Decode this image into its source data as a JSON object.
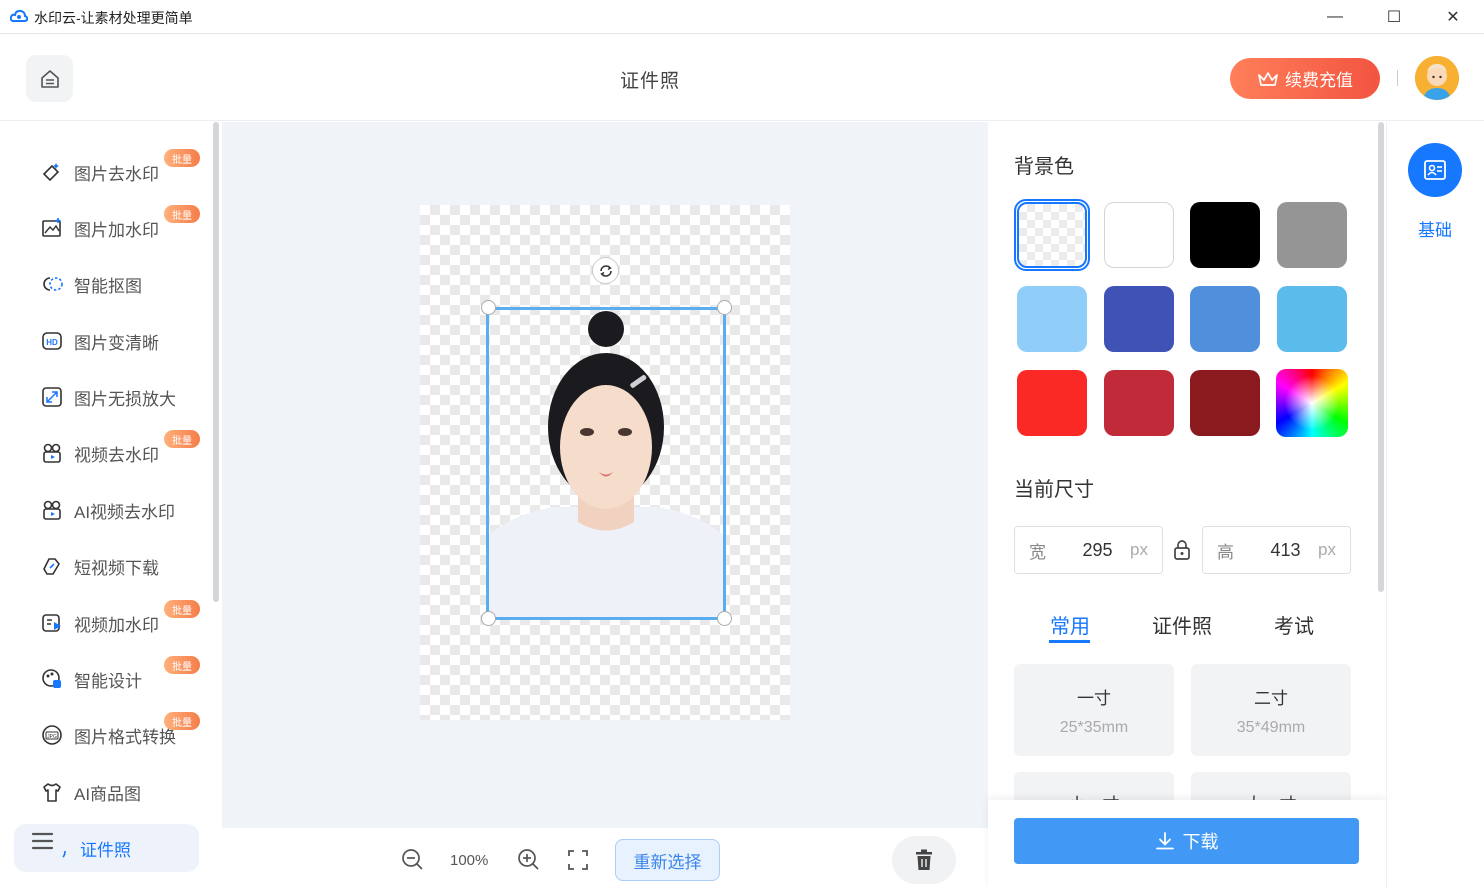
{
  "window": {
    "title": "水印云-让素材处理更简单",
    "minimize": "—",
    "maximize": "☐",
    "close": "✕"
  },
  "header": {
    "page_title": "证件照",
    "recharge_label": "续费充值"
  },
  "sidebar": {
    "items": [
      {
        "label": "图片去水印",
        "badge": "批量",
        "icon": "eraser-icon"
      },
      {
        "label": "图片加水印",
        "badge": "批量",
        "icon": "image-add-icon"
      },
      {
        "label": "智能抠图",
        "badge": "",
        "icon": "cutout-icon"
      },
      {
        "label": "图片变清晰",
        "badge": "",
        "icon": "hd-icon"
      },
      {
        "label": "图片无损放大",
        "badge": "",
        "icon": "enlarge-icon"
      },
      {
        "label": "视频去水印",
        "badge": "批量",
        "icon": "video-eraser-icon"
      },
      {
        "label": "AI视频去水印",
        "badge": "",
        "icon": "ai-video-icon"
      },
      {
        "label": "短视频下载",
        "badge": "",
        "icon": "link-download-icon"
      },
      {
        "label": "视频加水印",
        "badge": "批量",
        "icon": "video-add-icon"
      },
      {
        "label": "智能设计",
        "badge": "批量",
        "icon": "design-icon"
      },
      {
        "label": "图片格式转换",
        "badge": "批量",
        "icon": "jpg-icon"
      },
      {
        "label": "AI商品图",
        "badge": "",
        "icon": "shirt-icon"
      },
      {
        "label": "证件照",
        "badge": "",
        "icon": "id-photo-icon"
      }
    ]
  },
  "canvas": {
    "zoom": "100%",
    "reselect_label": "重新选择"
  },
  "panel": {
    "background_label": "背景色",
    "swatches": [
      "transparent",
      "#ffffff",
      "#000000",
      "#959595",
      "#90cdf8",
      "#3f52b6",
      "#4f8fdb",
      "#5bbbeb",
      "#fa2925",
      "#c12a38",
      "#8b1a1e",
      "gradient"
    ],
    "size_label": "当前尺寸",
    "width_label": "宽",
    "width_value": "295",
    "height_label": "高",
    "height_value": "413",
    "unit": "px",
    "tabs": [
      "常用",
      "证件照",
      "考试"
    ],
    "size_cards": [
      {
        "name": "一寸",
        "spec": "25*35mm"
      },
      {
        "name": "二寸",
        "spec": "35*49mm"
      },
      {
        "name": "小一寸",
        "spec": ""
      },
      {
        "name": "大一寸",
        "spec": ""
      }
    ],
    "download_label": "下载"
  },
  "far_right": {
    "basic_label": "基础"
  },
  "colors": {
    "accent": "#1677ff",
    "download": "#4199f5",
    "recharge": "#f25440",
    "badge": "#f47d4a"
  }
}
